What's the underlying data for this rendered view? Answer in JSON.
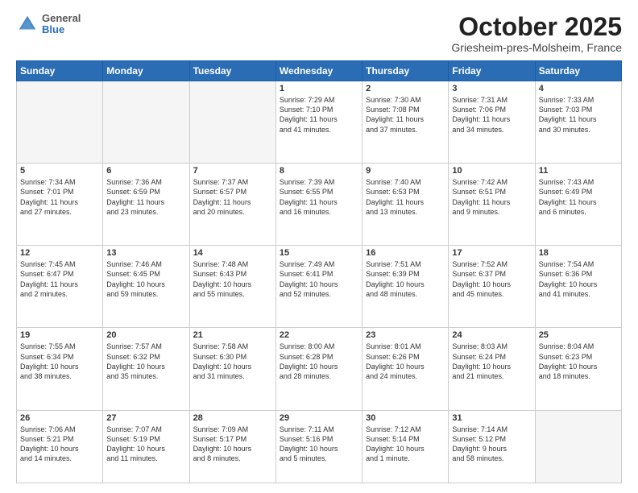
{
  "header": {
    "logo_general": "General",
    "logo_blue": "Blue",
    "month": "October 2025",
    "location": "Griesheim-pres-Molsheim, France"
  },
  "days_of_week": [
    "Sunday",
    "Monday",
    "Tuesday",
    "Wednesday",
    "Thursday",
    "Friday",
    "Saturday"
  ],
  "weeks": [
    [
      {
        "day": "",
        "content": ""
      },
      {
        "day": "",
        "content": ""
      },
      {
        "day": "",
        "content": ""
      },
      {
        "day": "1",
        "content": "Sunrise: 7:29 AM\nSunset: 7:10 PM\nDaylight: 11 hours\nand 41 minutes."
      },
      {
        "day": "2",
        "content": "Sunrise: 7:30 AM\nSunset: 7:08 PM\nDaylight: 11 hours\nand 37 minutes."
      },
      {
        "day": "3",
        "content": "Sunrise: 7:31 AM\nSunset: 7:06 PM\nDaylight: 11 hours\nand 34 minutes."
      },
      {
        "day": "4",
        "content": "Sunrise: 7:33 AM\nSunset: 7:03 PM\nDaylight: 11 hours\nand 30 minutes."
      }
    ],
    [
      {
        "day": "5",
        "content": "Sunrise: 7:34 AM\nSunset: 7:01 PM\nDaylight: 11 hours\nand 27 minutes."
      },
      {
        "day": "6",
        "content": "Sunrise: 7:36 AM\nSunset: 6:59 PM\nDaylight: 11 hours\nand 23 minutes."
      },
      {
        "day": "7",
        "content": "Sunrise: 7:37 AM\nSunset: 6:57 PM\nDaylight: 11 hours\nand 20 minutes."
      },
      {
        "day": "8",
        "content": "Sunrise: 7:39 AM\nSunset: 6:55 PM\nDaylight: 11 hours\nand 16 minutes."
      },
      {
        "day": "9",
        "content": "Sunrise: 7:40 AM\nSunset: 6:53 PM\nDaylight: 11 hours\nand 13 minutes."
      },
      {
        "day": "10",
        "content": "Sunrise: 7:42 AM\nSunset: 6:51 PM\nDaylight: 11 hours\nand 9 minutes."
      },
      {
        "day": "11",
        "content": "Sunrise: 7:43 AM\nSunset: 6:49 PM\nDaylight: 11 hours\nand 6 minutes."
      }
    ],
    [
      {
        "day": "12",
        "content": "Sunrise: 7:45 AM\nSunset: 6:47 PM\nDaylight: 11 hours\nand 2 minutes."
      },
      {
        "day": "13",
        "content": "Sunrise: 7:46 AM\nSunset: 6:45 PM\nDaylight: 10 hours\nand 59 minutes."
      },
      {
        "day": "14",
        "content": "Sunrise: 7:48 AM\nSunset: 6:43 PM\nDaylight: 10 hours\nand 55 minutes."
      },
      {
        "day": "15",
        "content": "Sunrise: 7:49 AM\nSunset: 6:41 PM\nDaylight: 10 hours\nand 52 minutes."
      },
      {
        "day": "16",
        "content": "Sunrise: 7:51 AM\nSunset: 6:39 PM\nDaylight: 10 hours\nand 48 minutes."
      },
      {
        "day": "17",
        "content": "Sunrise: 7:52 AM\nSunset: 6:37 PM\nDaylight: 10 hours\nand 45 minutes."
      },
      {
        "day": "18",
        "content": "Sunrise: 7:54 AM\nSunset: 6:36 PM\nDaylight: 10 hours\nand 41 minutes."
      }
    ],
    [
      {
        "day": "19",
        "content": "Sunrise: 7:55 AM\nSunset: 6:34 PM\nDaylight: 10 hours\nand 38 minutes."
      },
      {
        "day": "20",
        "content": "Sunrise: 7:57 AM\nSunset: 6:32 PM\nDaylight: 10 hours\nand 35 minutes."
      },
      {
        "day": "21",
        "content": "Sunrise: 7:58 AM\nSunset: 6:30 PM\nDaylight: 10 hours\nand 31 minutes."
      },
      {
        "day": "22",
        "content": "Sunrise: 8:00 AM\nSunset: 6:28 PM\nDaylight: 10 hours\nand 28 minutes."
      },
      {
        "day": "23",
        "content": "Sunrise: 8:01 AM\nSunset: 6:26 PM\nDaylight: 10 hours\nand 24 minutes."
      },
      {
        "day": "24",
        "content": "Sunrise: 8:03 AM\nSunset: 6:24 PM\nDaylight: 10 hours\nand 21 minutes."
      },
      {
        "day": "25",
        "content": "Sunrise: 8:04 AM\nSunset: 6:23 PM\nDaylight: 10 hours\nand 18 minutes."
      }
    ],
    [
      {
        "day": "26",
        "content": "Sunrise: 7:06 AM\nSunset: 5:21 PM\nDaylight: 10 hours\nand 14 minutes."
      },
      {
        "day": "27",
        "content": "Sunrise: 7:07 AM\nSunset: 5:19 PM\nDaylight: 10 hours\nand 11 minutes."
      },
      {
        "day": "28",
        "content": "Sunrise: 7:09 AM\nSunset: 5:17 PM\nDaylight: 10 hours\nand 8 minutes."
      },
      {
        "day": "29",
        "content": "Sunrise: 7:11 AM\nSunset: 5:16 PM\nDaylight: 10 hours\nand 5 minutes."
      },
      {
        "day": "30",
        "content": "Sunrise: 7:12 AM\nSunset: 5:14 PM\nDaylight: 10 hours\nand 1 minute."
      },
      {
        "day": "31",
        "content": "Sunrise: 7:14 AM\nSunset: 5:12 PM\nDaylight: 9 hours\nand 58 minutes."
      },
      {
        "day": "",
        "content": ""
      }
    ]
  ]
}
